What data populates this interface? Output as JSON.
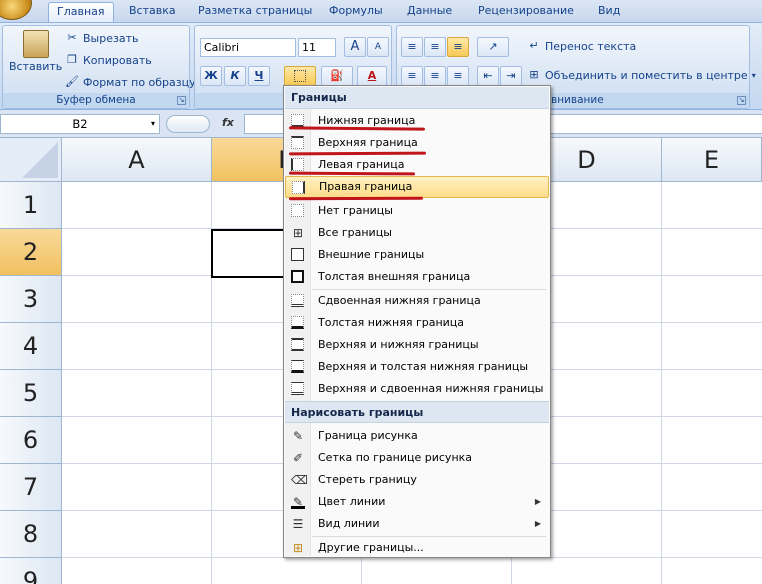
{
  "tabs": [
    "Главная",
    "Вставка",
    "Разметка страницы",
    "Формулы",
    "Данные",
    "Рецензирование",
    "Вид"
  ],
  "clipboard": {
    "paste": "Вставить",
    "cut": "Вырезать",
    "copy": "Копировать",
    "format_painter": "Формат по образцу",
    "group": "Буфер обмена"
  },
  "font": {
    "name": "Calibri",
    "size": "11",
    "bold": "Ж",
    "italic": "К",
    "underline": "Ч",
    "grow": "A",
    "shrink": "A",
    "color_letter": "A",
    "group": "Шр"
  },
  "alignment": {
    "wrap": "Перенос текста",
    "merge": "Объединить и поместить в центре",
    "group": "внивание"
  },
  "name_box": "B2",
  "fx": "fx",
  "columns": [
    "A",
    "B",
    "C",
    "D",
    "E"
  ],
  "rows": [
    "1",
    "2",
    "3",
    "4",
    "5",
    "6",
    "7",
    "8",
    "9"
  ],
  "menu": {
    "header1": "Границы",
    "items1": [
      "Нижняя граница",
      "Верхняя граница",
      "Левая граница",
      "Правая граница",
      "Нет границы",
      "Все границы",
      "Внешние границы",
      "Толстая внешняя граница"
    ],
    "items2": [
      "Сдвоенная нижняя граница",
      "Толстая нижняя граница",
      "Верхняя и нижняя границы",
      "Верхняя и толстая нижняя границы",
      "Верхняя и сдвоенная нижняя границы"
    ],
    "header2": "Нарисовать границы",
    "items3": [
      "Граница рисунка",
      "Сетка по границе рисунка",
      "Стереть границу",
      "Цвет линии",
      "Вид линии"
    ],
    "items4": [
      "Другие границы..."
    ]
  },
  "colors": {
    "accent_red": "#c0161b",
    "selection": "#f1c15f",
    "ribbon": "#d0dff2"
  }
}
